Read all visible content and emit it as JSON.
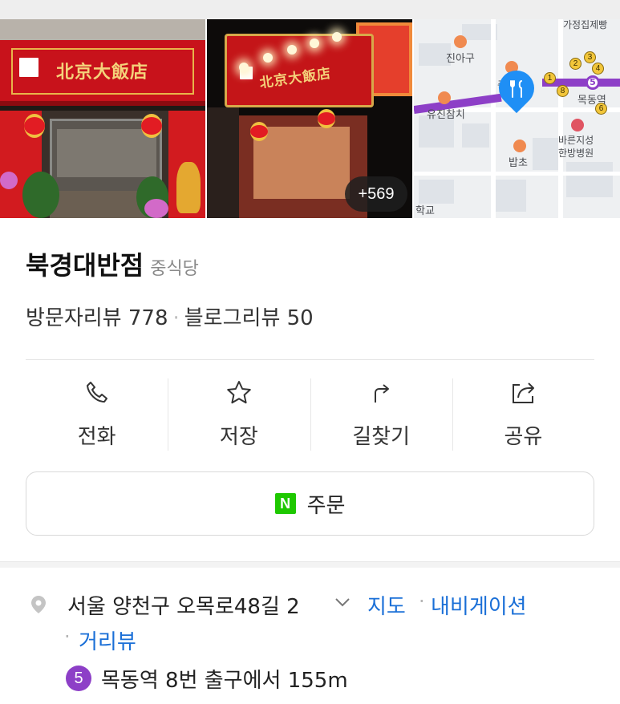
{
  "photos": {
    "sign_text": "北京大飯店",
    "more_count": "+569",
    "map": {
      "labels": {
        "top": "가정집제빵",
        "jinagu": "진아구",
        "jug": "죽",
        "yujin": "유진참치",
        "station": "목동역",
        "bareun1": "바른지성",
        "bareun2": "한방병원",
        "bapcho": "밥초",
        "school": "학교"
      },
      "exits": [
        "1",
        "2",
        "3",
        "4",
        "6",
        "8"
      ],
      "line_number": "5",
      "pin_icon": "fork-knife-icon"
    }
  },
  "place": {
    "name": "북경대반점",
    "category": "중식당",
    "visitor_reviews": "방문자리뷰 778",
    "separator": "·",
    "blog_reviews": "블로그리뷰 50"
  },
  "actions": [
    {
      "label": "전화",
      "icon": "phone-icon"
    },
    {
      "label": "저장",
      "icon": "star-icon"
    },
    {
      "label": "길찾기",
      "icon": "directions-icon"
    },
    {
      "label": "공유",
      "icon": "share-icon"
    }
  ],
  "order": {
    "badge": "N",
    "label": "주문"
  },
  "address": {
    "text": "서울 양천구 오목로48길 2",
    "links": {
      "map": "지도",
      "navigation": "내비게이션",
      "street_view": "거리뷰"
    },
    "dot": "·"
  },
  "subway": {
    "line": "5",
    "text": "목동역 8번 출구에서 155m"
  },
  "colors": {
    "link": "#1a6fd7",
    "metro_line_5": "#8d3fc7",
    "naver_green": "#1ec800",
    "pin_blue": "#1f8ff5"
  }
}
